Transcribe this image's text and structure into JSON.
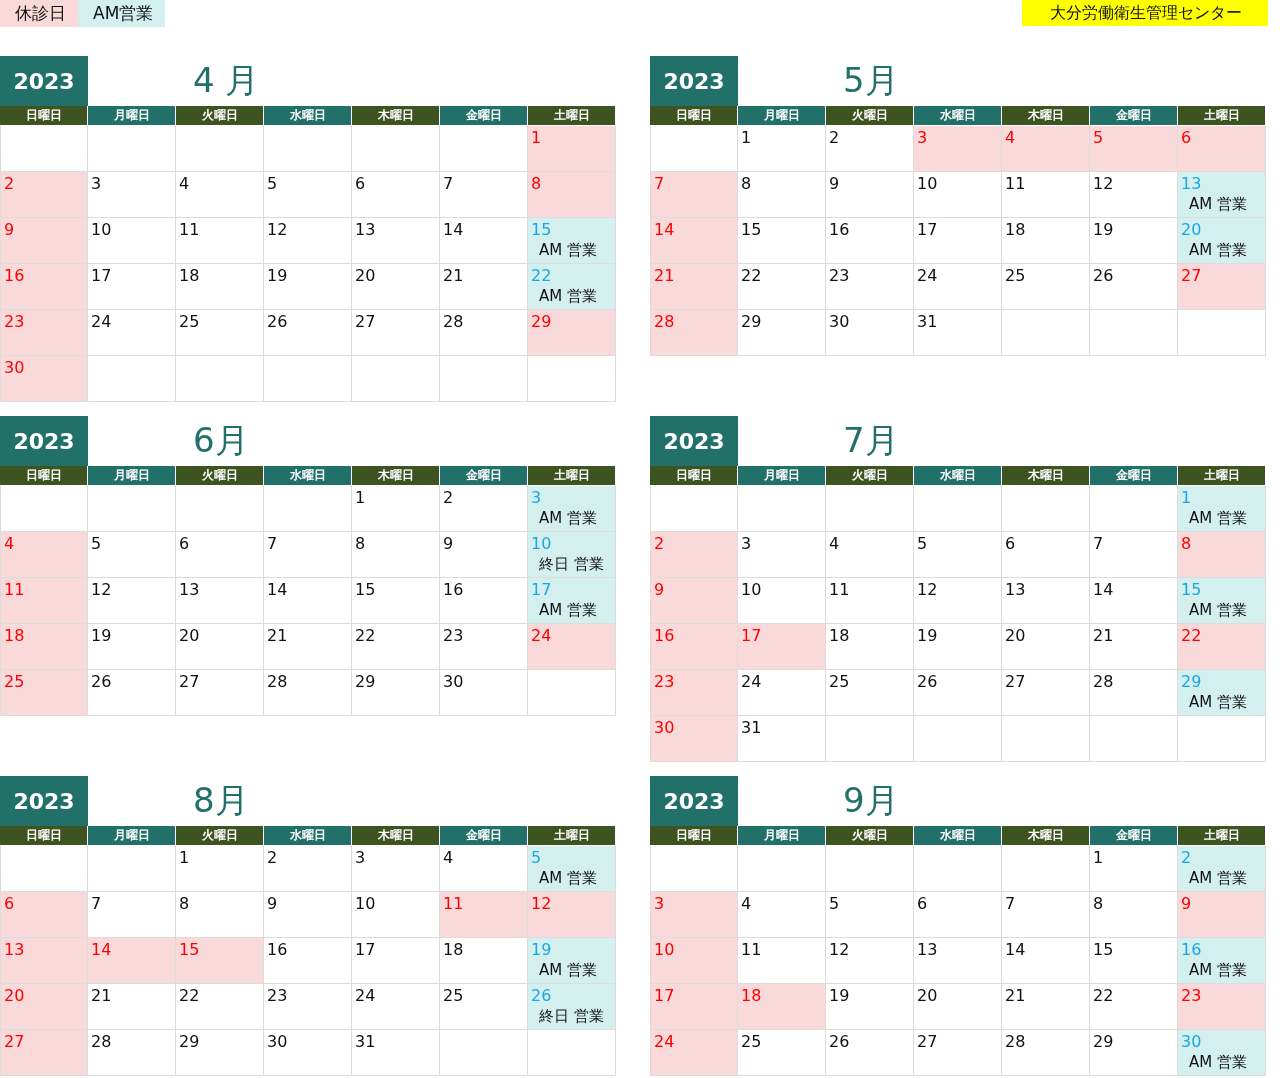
{
  "legend": [
    {
      "label": "休診日",
      "kind": "closed"
    },
    {
      "label": "AM営業",
      "kind": "open"
    }
  ],
  "organization": "大分労働衛生管理センター",
  "months": [
    {
      "year": "2023",
      "title": "4 月",
      "weekdays": [
        {
          "label": "日曜日",
          "color": "#3d5320"
        },
        {
          "label": "月曜日",
          "color": "#22706a"
        },
        {
          "label": "火曜日",
          "color": "#3d5320"
        },
        {
          "label": "水曜日",
          "color": "#22706a"
        },
        {
          "label": "木曜日",
          "color": "#3d5320"
        },
        {
          "label": "金曜日",
          "color": "#22706a"
        },
        {
          "label": "土曜日",
          "color": "#3d5320"
        }
      ],
      "weeks": [
        [
          {
            "kind": "blank"
          },
          {
            "kind": "blank"
          },
          {
            "kind": "blank"
          },
          {
            "kind": "blank"
          },
          {
            "kind": "blank"
          },
          {
            "kind": "blank"
          },
          {
            "kind": "closed",
            "day": "1"
          }
        ],
        [
          {
            "kind": "closed",
            "day": "2"
          },
          {
            "kind": "plain",
            "day": "3"
          },
          {
            "kind": "plain",
            "day": "4"
          },
          {
            "kind": "plain",
            "day": "5"
          },
          {
            "kind": "plain",
            "day": "6"
          },
          {
            "kind": "plain",
            "day": "7"
          },
          {
            "kind": "closed",
            "day": "8"
          }
        ],
        [
          {
            "kind": "closed",
            "day": "9"
          },
          {
            "kind": "plain",
            "day": "10"
          },
          {
            "kind": "plain",
            "day": "11"
          },
          {
            "kind": "plain",
            "day": "12"
          },
          {
            "kind": "plain",
            "day": "13"
          },
          {
            "kind": "plain",
            "day": "14"
          },
          {
            "kind": "open",
            "day": "15",
            "note": "AM 営業"
          }
        ],
        [
          {
            "kind": "closed",
            "day": "16"
          },
          {
            "kind": "plain",
            "day": "17"
          },
          {
            "kind": "plain",
            "day": "18"
          },
          {
            "kind": "plain",
            "day": "19"
          },
          {
            "kind": "plain",
            "day": "20"
          },
          {
            "kind": "plain",
            "day": "21"
          },
          {
            "kind": "open",
            "day": "22",
            "note": "AM 営業"
          }
        ],
        [
          {
            "kind": "closed",
            "day": "23"
          },
          {
            "kind": "plain",
            "day": "24"
          },
          {
            "kind": "plain",
            "day": "25"
          },
          {
            "kind": "plain",
            "day": "26"
          },
          {
            "kind": "plain",
            "day": "27"
          },
          {
            "kind": "plain",
            "day": "28"
          },
          {
            "kind": "closed",
            "day": "29"
          }
        ],
        [
          {
            "kind": "closed",
            "day": "30"
          },
          {
            "kind": "blank"
          },
          {
            "kind": "blank"
          },
          {
            "kind": "blank"
          },
          {
            "kind": "blank"
          },
          {
            "kind": "blank"
          },
          {
            "kind": "blank"
          }
        ]
      ]
    },
    {
      "year": "2023",
      "title": "5月",
      "weekdays": [
        {
          "label": "日曜日",
          "color": "#3d5320"
        },
        {
          "label": "月曜日",
          "color": "#22706a"
        },
        {
          "label": "火曜日",
          "color": "#3d5320"
        },
        {
          "label": "水曜日",
          "color": "#22706a"
        },
        {
          "label": "木曜日",
          "color": "#3d5320"
        },
        {
          "label": "金曜日",
          "color": "#22706a"
        },
        {
          "label": "土曜日",
          "color": "#3d5320"
        }
      ],
      "weeks": [
        [
          {
            "kind": "blank"
          },
          {
            "kind": "plain",
            "day": "1"
          },
          {
            "kind": "plain",
            "day": "2"
          },
          {
            "kind": "closed",
            "day": "3"
          },
          {
            "kind": "closed",
            "day": "4"
          },
          {
            "kind": "closed",
            "day": "5"
          },
          {
            "kind": "closed",
            "day": "6"
          }
        ],
        [
          {
            "kind": "closed",
            "day": "7"
          },
          {
            "kind": "plain",
            "day": "8"
          },
          {
            "kind": "plain",
            "day": "9"
          },
          {
            "kind": "plain",
            "day": "10"
          },
          {
            "kind": "plain",
            "day": "11"
          },
          {
            "kind": "plain",
            "day": "12"
          },
          {
            "kind": "open",
            "day": "13",
            "note": "AM 営業"
          }
        ],
        [
          {
            "kind": "closed",
            "day": "14"
          },
          {
            "kind": "plain",
            "day": "15"
          },
          {
            "kind": "plain",
            "day": "16"
          },
          {
            "kind": "plain",
            "day": "17"
          },
          {
            "kind": "plain",
            "day": "18"
          },
          {
            "kind": "plain",
            "day": "19"
          },
          {
            "kind": "open",
            "day": "20",
            "note": "AM 営業"
          }
        ],
        [
          {
            "kind": "closed",
            "day": "21"
          },
          {
            "kind": "plain",
            "day": "22"
          },
          {
            "kind": "plain",
            "day": "23"
          },
          {
            "kind": "plain",
            "day": "24"
          },
          {
            "kind": "plain",
            "day": "25"
          },
          {
            "kind": "plain",
            "day": "26"
          },
          {
            "kind": "closed",
            "day": "27"
          }
        ],
        [
          {
            "kind": "closed",
            "day": "28"
          },
          {
            "kind": "plain",
            "day": "29"
          },
          {
            "kind": "plain",
            "day": "30"
          },
          {
            "kind": "plain",
            "day": "31"
          },
          {
            "kind": "blank"
          },
          {
            "kind": "blank"
          },
          {
            "kind": "blank"
          }
        ]
      ]
    },
    {
      "year": "2023",
      "title": "6月",
      "weekdays": [
        {
          "label": "日曜日",
          "color": "#3d5320"
        },
        {
          "label": "月曜日",
          "color": "#22706a"
        },
        {
          "label": "火曜日",
          "color": "#3d5320"
        },
        {
          "label": "水曜日",
          "color": "#22706a"
        },
        {
          "label": "木曜日",
          "color": "#3d5320"
        },
        {
          "label": "金曜日",
          "color": "#22706a"
        },
        {
          "label": "土曜日",
          "color": "#3d5320"
        }
      ],
      "weeks": [
        [
          {
            "kind": "blank"
          },
          {
            "kind": "blank"
          },
          {
            "kind": "blank"
          },
          {
            "kind": "blank"
          },
          {
            "kind": "plain",
            "day": "1"
          },
          {
            "kind": "plain",
            "day": "2"
          },
          {
            "kind": "open",
            "day": "3",
            "note": "AM 営業"
          }
        ],
        [
          {
            "kind": "closed",
            "day": "4"
          },
          {
            "kind": "plain",
            "day": "5"
          },
          {
            "kind": "plain",
            "day": "6"
          },
          {
            "kind": "plain",
            "day": "7"
          },
          {
            "kind": "plain",
            "day": "8"
          },
          {
            "kind": "plain",
            "day": "9"
          },
          {
            "kind": "open",
            "day": "10",
            "note": "終日 営業"
          }
        ],
        [
          {
            "kind": "closed",
            "day": "11"
          },
          {
            "kind": "plain",
            "day": "12"
          },
          {
            "kind": "plain",
            "day": "13"
          },
          {
            "kind": "plain",
            "day": "14"
          },
          {
            "kind": "plain",
            "day": "15"
          },
          {
            "kind": "plain",
            "day": "16"
          },
          {
            "kind": "open",
            "day": "17",
            "note": "AM 営業"
          }
        ],
        [
          {
            "kind": "closed",
            "day": "18"
          },
          {
            "kind": "plain",
            "day": "19"
          },
          {
            "kind": "plain",
            "day": "20"
          },
          {
            "kind": "plain",
            "day": "21"
          },
          {
            "kind": "plain",
            "day": "22"
          },
          {
            "kind": "plain",
            "day": "23"
          },
          {
            "kind": "closed",
            "day": "24"
          }
        ],
        [
          {
            "kind": "closed",
            "day": "25"
          },
          {
            "kind": "plain",
            "day": "26"
          },
          {
            "kind": "plain",
            "day": "27"
          },
          {
            "kind": "plain",
            "day": "28"
          },
          {
            "kind": "plain",
            "day": "29"
          },
          {
            "kind": "plain",
            "day": "30"
          },
          {
            "kind": "blank"
          }
        ]
      ]
    },
    {
      "year": "2023",
      "title": "7月",
      "weekdays": [
        {
          "label": "日曜日",
          "color": "#3d5320"
        },
        {
          "label": "月曜日",
          "color": "#22706a"
        },
        {
          "label": "火曜日",
          "color": "#3d5320"
        },
        {
          "label": "水曜日",
          "color": "#22706a"
        },
        {
          "label": "木曜日",
          "color": "#3d5320"
        },
        {
          "label": "金曜日",
          "color": "#22706a"
        },
        {
          "label": "土曜日",
          "color": "#3d5320"
        }
      ],
      "weeks": [
        [
          {
            "kind": "blank"
          },
          {
            "kind": "blank"
          },
          {
            "kind": "blank"
          },
          {
            "kind": "blank"
          },
          {
            "kind": "blank"
          },
          {
            "kind": "blank"
          },
          {
            "kind": "open",
            "day": "1",
            "note": "AM 営業"
          }
        ],
        [
          {
            "kind": "closed",
            "day": "2"
          },
          {
            "kind": "plain",
            "day": "3"
          },
          {
            "kind": "plain",
            "day": "4"
          },
          {
            "kind": "plain",
            "day": "5"
          },
          {
            "kind": "plain",
            "day": "6"
          },
          {
            "kind": "plain",
            "day": "7"
          },
          {
            "kind": "closed",
            "day": "8"
          }
        ],
        [
          {
            "kind": "closed",
            "day": "9"
          },
          {
            "kind": "plain",
            "day": "10"
          },
          {
            "kind": "plain",
            "day": "11"
          },
          {
            "kind": "plain",
            "day": "12"
          },
          {
            "kind": "plain",
            "day": "13"
          },
          {
            "kind": "plain",
            "day": "14"
          },
          {
            "kind": "open",
            "day": "15",
            "note": "AM 営業"
          }
        ],
        [
          {
            "kind": "closed",
            "day": "16"
          },
          {
            "kind": "closed",
            "day": "17"
          },
          {
            "kind": "plain",
            "day": "18"
          },
          {
            "kind": "plain",
            "day": "19"
          },
          {
            "kind": "plain",
            "day": "20"
          },
          {
            "kind": "plain",
            "day": "21"
          },
          {
            "kind": "closed",
            "day": "22"
          }
        ],
        [
          {
            "kind": "closed",
            "day": "23"
          },
          {
            "kind": "plain",
            "day": "24"
          },
          {
            "kind": "plain",
            "day": "25"
          },
          {
            "kind": "plain",
            "day": "26"
          },
          {
            "kind": "plain",
            "day": "27"
          },
          {
            "kind": "plain",
            "day": "28"
          },
          {
            "kind": "open",
            "day": "29",
            "note": "AM 営業"
          }
        ],
        [
          {
            "kind": "closed",
            "day": "30"
          },
          {
            "kind": "plain",
            "day": "31"
          },
          {
            "kind": "blank"
          },
          {
            "kind": "blank"
          },
          {
            "kind": "blank"
          },
          {
            "kind": "blank"
          },
          {
            "kind": "blank"
          }
        ]
      ]
    },
    {
      "year": "2023",
      "title": "8月",
      "weekdays": [
        {
          "label": "日曜日",
          "color": "#3d5320"
        },
        {
          "label": "月曜日",
          "color": "#22706a"
        },
        {
          "label": "火曜日",
          "color": "#3d5320"
        },
        {
          "label": "水曜日",
          "color": "#22706a"
        },
        {
          "label": "木曜日",
          "color": "#3d5320"
        },
        {
          "label": "金曜日",
          "color": "#22706a"
        },
        {
          "label": "土曜日",
          "color": "#3d5320"
        }
      ],
      "weeks": [
        [
          {
            "kind": "blank"
          },
          {
            "kind": "blank"
          },
          {
            "kind": "plain",
            "day": "1"
          },
          {
            "kind": "plain",
            "day": "2"
          },
          {
            "kind": "plain",
            "day": "3"
          },
          {
            "kind": "plain",
            "day": "4"
          },
          {
            "kind": "open",
            "day": "5",
            "note": "AM 営業"
          }
        ],
        [
          {
            "kind": "closed",
            "day": "6"
          },
          {
            "kind": "plain",
            "day": "7"
          },
          {
            "kind": "plain",
            "day": "8"
          },
          {
            "kind": "plain",
            "day": "9"
          },
          {
            "kind": "plain",
            "day": "10"
          },
          {
            "kind": "closed",
            "day": "11"
          },
          {
            "kind": "closed",
            "day": "12"
          }
        ],
        [
          {
            "kind": "closed",
            "day": "13"
          },
          {
            "kind": "closed",
            "day": "14"
          },
          {
            "kind": "closed",
            "day": "15"
          },
          {
            "kind": "plain",
            "day": "16"
          },
          {
            "kind": "plain",
            "day": "17"
          },
          {
            "kind": "plain",
            "day": "18"
          },
          {
            "kind": "open",
            "day": "19",
            "note": "AM 営業"
          }
        ],
        [
          {
            "kind": "closed",
            "day": "20"
          },
          {
            "kind": "plain",
            "day": "21"
          },
          {
            "kind": "plain",
            "day": "22"
          },
          {
            "kind": "plain",
            "day": "23"
          },
          {
            "kind": "plain",
            "day": "24"
          },
          {
            "kind": "plain",
            "day": "25"
          },
          {
            "kind": "open",
            "day": "26",
            "note": "終日 営業"
          }
        ],
        [
          {
            "kind": "closed",
            "day": "27"
          },
          {
            "kind": "plain",
            "day": "28"
          },
          {
            "kind": "plain",
            "day": "29"
          },
          {
            "kind": "plain",
            "day": "30"
          },
          {
            "kind": "plain",
            "day": "31"
          },
          {
            "kind": "blank"
          },
          {
            "kind": "blank"
          }
        ]
      ]
    },
    {
      "year": "2023",
      "title": "9月",
      "weekdays": [
        {
          "label": "日曜日",
          "color": "#3d5320"
        },
        {
          "label": "月曜日",
          "color": "#22706a"
        },
        {
          "label": "火曜日",
          "color": "#3d5320"
        },
        {
          "label": "水曜日",
          "color": "#22706a"
        },
        {
          "label": "木曜日",
          "color": "#3d5320"
        },
        {
          "label": "金曜日",
          "color": "#22706a"
        },
        {
          "label": "土曜日",
          "color": "#3d5320"
        }
      ],
      "weeks": [
        [
          {
            "kind": "blank"
          },
          {
            "kind": "blank"
          },
          {
            "kind": "blank"
          },
          {
            "kind": "blank"
          },
          {
            "kind": "blank"
          },
          {
            "kind": "plain",
            "day": "1"
          },
          {
            "kind": "open",
            "day": "2",
            "note": "AM 営業"
          }
        ],
        [
          {
            "kind": "closed",
            "day": "3"
          },
          {
            "kind": "plain",
            "day": "4"
          },
          {
            "kind": "plain",
            "day": "5"
          },
          {
            "kind": "plain",
            "day": "6"
          },
          {
            "kind": "plain",
            "day": "7"
          },
          {
            "kind": "plain",
            "day": "8"
          },
          {
            "kind": "closed",
            "day": "9"
          }
        ],
        [
          {
            "kind": "closed",
            "day": "10"
          },
          {
            "kind": "plain",
            "day": "11"
          },
          {
            "kind": "plain",
            "day": "12"
          },
          {
            "kind": "plain",
            "day": "13"
          },
          {
            "kind": "plain",
            "day": "14"
          },
          {
            "kind": "plain",
            "day": "15"
          },
          {
            "kind": "open",
            "day": "16",
            "note": "AM 営業"
          }
        ],
        [
          {
            "kind": "closed",
            "day": "17"
          },
          {
            "kind": "closed",
            "day": "18"
          },
          {
            "kind": "plain",
            "day": "19"
          },
          {
            "kind": "plain",
            "day": "20"
          },
          {
            "kind": "plain",
            "day": "21"
          },
          {
            "kind": "plain",
            "day": "22"
          },
          {
            "kind": "closed",
            "day": "23"
          }
        ],
        [
          {
            "kind": "closed",
            "day": "24"
          },
          {
            "kind": "plain",
            "day": "25"
          },
          {
            "kind": "plain",
            "day": "26"
          },
          {
            "kind": "plain",
            "day": "27"
          },
          {
            "kind": "plain",
            "day": "28"
          },
          {
            "kind": "plain",
            "day": "29"
          },
          {
            "kind": "open",
            "day": "30",
            "note": "AM 営業"
          }
        ]
      ]
    }
  ]
}
